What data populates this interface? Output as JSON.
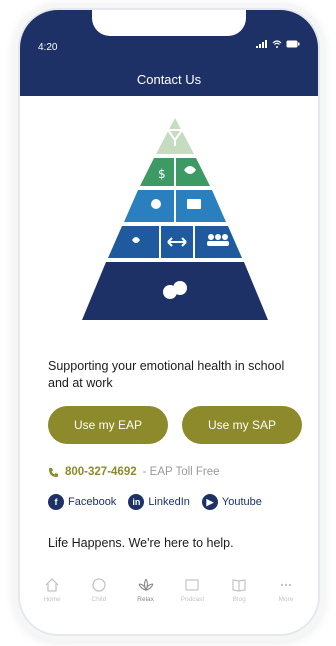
{
  "status_bar": {
    "time": "4:20"
  },
  "header": {
    "title": "Contact Us"
  },
  "tagline": "Supporting your emotional health in school and at work",
  "buttons": {
    "eap": "Use my EAP",
    "sap": "Use my SAP"
  },
  "phone": {
    "number": "800-327-4692",
    "label": "- EAP Toll Free"
  },
  "social": [
    {
      "label": "Facebook",
      "icon": "facebook-icon"
    },
    {
      "label": "LinkedIn",
      "icon": "linkedin-icon"
    },
    {
      "label": "Youtube",
      "icon": "youtube-icon"
    }
  ],
  "footer_text": "Life Happens. We're here to help.",
  "tabs": [
    {
      "label": "Home",
      "icon": "home-icon"
    },
    {
      "label": "Child",
      "icon": "child-icon"
    },
    {
      "label": "Relax",
      "icon": "lotus-icon"
    },
    {
      "label": "Podcast",
      "icon": "podcast-icon"
    },
    {
      "label": "Blog",
      "icon": "book-icon"
    },
    {
      "label": "More",
      "icon": "more-icon"
    }
  ],
  "colors": {
    "header_bg": "#1d3166",
    "accent": "#8c8a2a",
    "pyramid_top": "#c5dcc1",
    "pyramid_green": "#3e9a64",
    "pyramid_blue_light": "#2a7fbf",
    "pyramid_blue": "#1f5a9e",
    "pyramid_navy": "#1d3166"
  }
}
